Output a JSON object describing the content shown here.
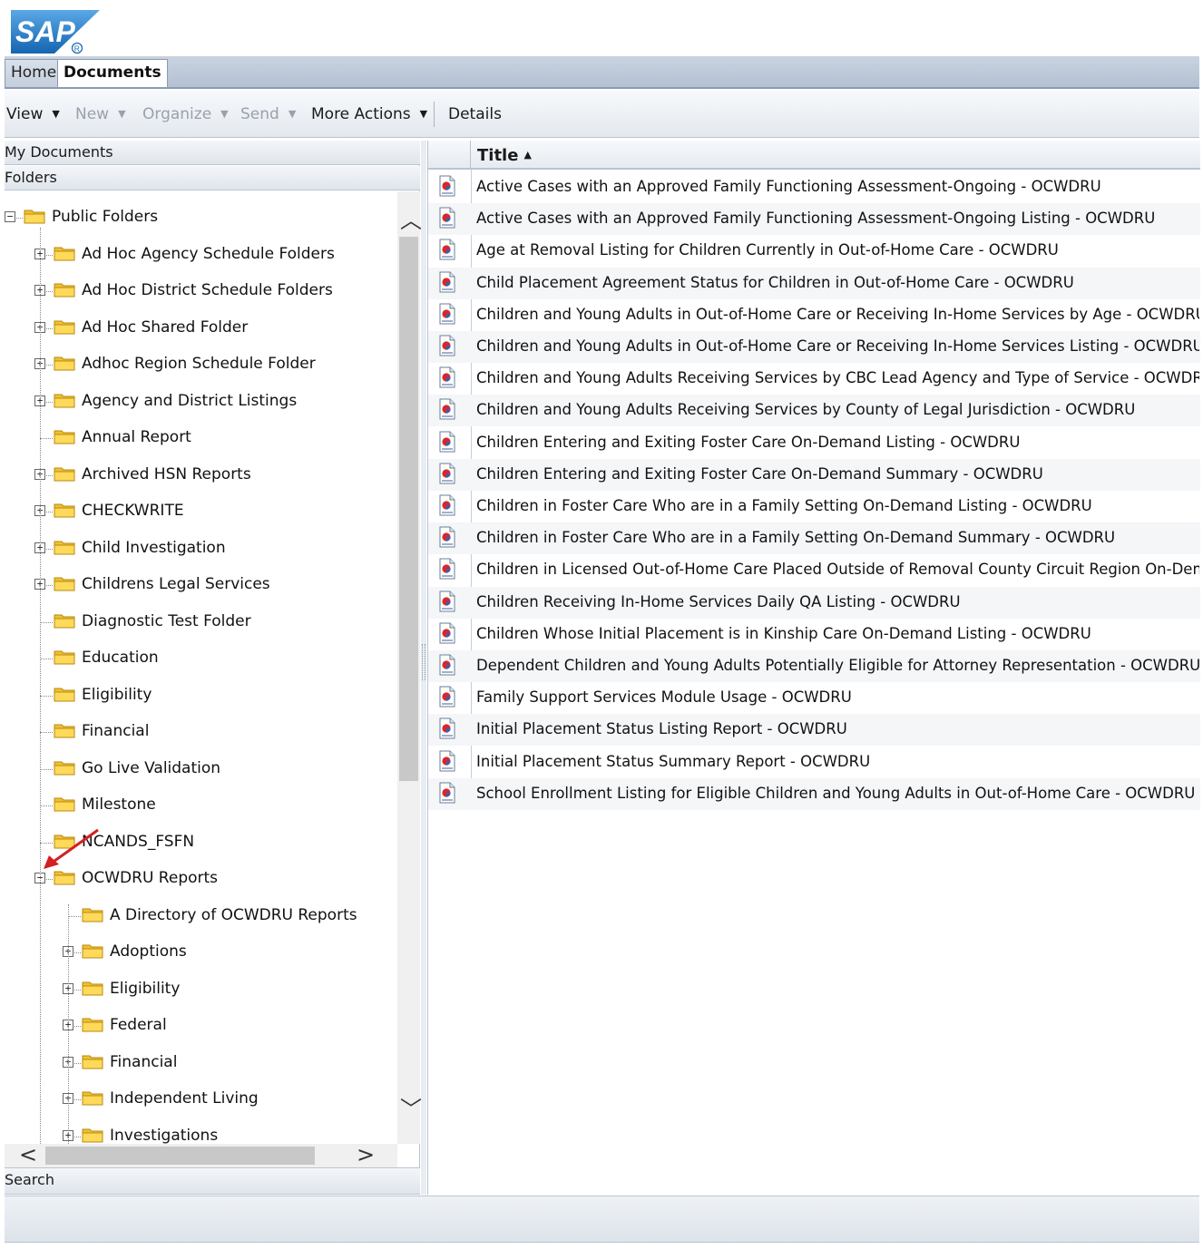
{
  "app": {
    "logo_text": "SAP",
    "accent_color": "#1f6fb5",
    "arrow_color": "#d42020"
  },
  "tabs": [
    {
      "label": "Home",
      "active": false
    },
    {
      "label": "Documents",
      "active": true
    }
  ],
  "toolbar": {
    "view_label": "View",
    "new_label": "New",
    "organize_label": "Organize",
    "send_label": "Send",
    "more_actions_label": "More Actions",
    "details_label": "Details"
  },
  "left_panel": {
    "my_documents_label": "My Documents",
    "folders_label": "Folders",
    "search_label": "Search",
    "tree": [
      {
        "label": "Public Folders",
        "toggle": "−",
        "icon": "folder-icon"
      },
      {
        "label": "Ad Hoc Agency Schedule Folders",
        "toggle": "+",
        "icon": "folder-icon"
      },
      {
        "label": "Ad Hoc District Schedule Folders",
        "toggle": "+",
        "icon": "folder-icon"
      },
      {
        "label": "Ad Hoc Shared Folder",
        "toggle": "+",
        "icon": "folder-icon"
      },
      {
        "label": "Adhoc Region Schedule Folder",
        "toggle": "+",
        "icon": "folder-icon"
      },
      {
        "label": "Agency and District Listings",
        "toggle": "+",
        "icon": "folder-icon"
      },
      {
        "label": "Annual Report",
        "toggle": "",
        "icon": "folder-icon"
      },
      {
        "label": "Archived HSN Reports",
        "toggle": "+",
        "icon": "folder-icon"
      },
      {
        "label": "CHECKWRITE",
        "toggle": "+",
        "icon": "folder-icon"
      },
      {
        "label": "Child Investigation",
        "toggle": "+",
        "icon": "folder-icon"
      },
      {
        "label": "Childrens Legal Services",
        "toggle": "+",
        "icon": "folder-icon"
      },
      {
        "label": "Diagnostic Test Folder",
        "toggle": "",
        "icon": "folder-icon"
      },
      {
        "label": "Education",
        "toggle": "",
        "icon": "folder-icon"
      },
      {
        "label": "Eligibility",
        "toggle": "",
        "icon": "folder-icon"
      },
      {
        "label": "Financial",
        "toggle": "",
        "icon": "folder-icon"
      },
      {
        "label": "Go Live Validation",
        "toggle": "",
        "icon": "folder-icon"
      },
      {
        "label": "Milestone",
        "toggle": "",
        "icon": "folder-icon"
      },
      {
        "label": "NCANDS_FSFN",
        "toggle": "",
        "icon": "folder-icon"
      },
      {
        "label": "OCWDRU Reports",
        "toggle": "−",
        "icon": "folder-icon"
      },
      {
        "label": "A Directory of OCWDRU Reports",
        "toggle": "",
        "icon": "folder-icon"
      },
      {
        "label": "Adoptions",
        "toggle": "+",
        "icon": "folder-icon"
      },
      {
        "label": "Eligibility",
        "toggle": "+",
        "icon": "folder-icon"
      },
      {
        "label": "Federal",
        "toggle": "+",
        "icon": "folder-icon"
      },
      {
        "label": "Financial",
        "toggle": "+",
        "icon": "folder-icon"
      },
      {
        "label": "Independent Living",
        "toggle": "+",
        "icon": "folder-icon"
      },
      {
        "label": "Investigations",
        "toggle": "+",
        "icon": "folder-icon"
      }
    ]
  },
  "right_panel": {
    "title_column": "Title",
    "sort_icon": "▲",
    "documents": [
      "Active Cases with an Approved Family Functioning Assessment-Ongoing - OCWDRU",
      "Active Cases with an Approved Family Functioning Assessment-Ongoing Listing - OCWDRU",
      "Age at Removal Listing for Children Currently in Out-of-Home Care - OCWDRU",
      "Child Placement Agreement Status for Children in Out-of-Home Care - OCWDRU",
      "Children and Young Adults in Out-of-Home Care or Receiving In-Home Services by Age - OCWDRU",
      "Children and Young Adults in Out-of-Home Care or Receiving In-Home Services Listing - OCWDRU",
      "Children and Young Adults Receiving Services by CBC Lead Agency and Type of Service - OCWDRU",
      "Children and Young Adults Receiving Services by County of Legal Jurisdiction - OCWDRU",
      "Children Entering and Exiting Foster Care On-Demand Listing - OCWDRU",
      "Children Entering and Exiting Foster Care On-Demand Summary - OCWDRU",
      "Children in Foster Care Who are in a Family Setting On-Demand Listing - OCWDRU",
      "Children in Foster Care Who are in a Family Setting On-Demand Summary - OCWDRU",
      "Children in Licensed Out-of-Home Care Placed Outside of Removal County Circuit Region On-Demand Listing",
      "Children Receiving In-Home Services Daily QA Listing - OCWDRU",
      "Children Whose Initial Placement is in Kinship Care On-Demand Listing - OCWDRU",
      "Dependent Children and Young Adults Potentially Eligible for Attorney Representation - OCWDRU",
      "Family Support Services Module Usage - OCWDRU",
      "Initial Placement Status Listing Report - OCWDRU",
      "Initial Placement Status Summary Report - OCWDRU",
      "School Enrollment Listing for Eligible Children and Young Adults in Out-of-Home Care - OCWDRU"
    ]
  }
}
